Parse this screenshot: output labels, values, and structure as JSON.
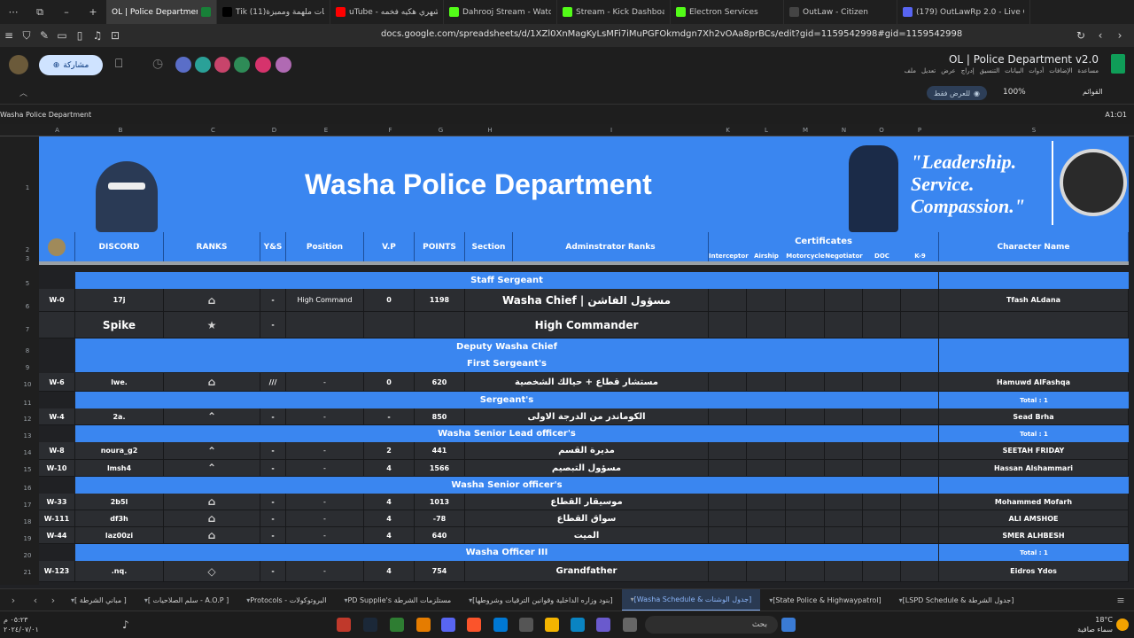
{
  "browser_tabs": [
    {
      "label": "OL | Police Department v2",
      "active": true,
      "color": "#188038"
    },
    {
      "label": "Tik (11)اقتباسات ملهمة ومميزة",
      "active": false,
      "color": "#000000"
    },
    {
      "label": "uTube - لعب شهري هكيه فخمه",
      "active": false,
      "color": "#ff0000"
    },
    {
      "label": "Dahrooj Stream - Watch Live o",
      "active": false,
      "color": "#53fc18"
    },
    {
      "label": "Stream - Kick Dashboard",
      "active": false,
      "color": "#53fc18"
    },
    {
      "label": "Electron Services",
      "active": false,
      "color": "#53fc18"
    },
    {
      "label": "OutLaw - Citizen",
      "active": false,
      "color": "#444444"
    },
    {
      "label": "(179) OutLawRp 2.0 - Live Conv",
      "active": false,
      "color": "#5865f2"
    }
  ],
  "url": "docs.google.com/spreadsheets/d/1XZl0XnMagKyLsMFi7iMuPGFOkmdgn7Xh2vOAa8prBCs/edit?gid=1159542998#gid=1159542998",
  "doc": {
    "title": "OL | Police Department v2.0",
    "menus": [
      "ملف",
      "تعديل",
      "عرض",
      "إدراج",
      "التنسيق",
      "البيانات",
      "أدوات",
      "الإضافات",
      "مساعدة"
    ],
    "share_label": "مشاركة",
    "view_only": "للعرض فقط",
    "zoom": "100%",
    "filter_label": "القوائم",
    "cell_ref": "A1:O1",
    "formula_text": "Washa Police Department"
  },
  "columns": [
    "A",
    "B",
    "C",
    "D",
    "E",
    "F",
    "G",
    "H",
    "I",
    "K",
    "L",
    "M",
    "N",
    "O",
    "P",
    "S"
  ],
  "rows": [
    "1",
    "2",
    "3",
    "5",
    "6",
    "7",
    "8",
    "9",
    "10",
    "11",
    "12",
    "13",
    "14",
    "15",
    "16",
    "17",
    "18",
    "19",
    "20",
    "21"
  ],
  "banner": {
    "title": "Washa Police Department",
    "quote": [
      "\"Leadership.",
      "Service.",
      "Compassion.\""
    ]
  },
  "headers": {
    "discord": "DISCORD",
    "ranks": "RANKS",
    "ys": "Y&S",
    "position": "Position",
    "vp": "V.P",
    "points": "POINTS",
    "section": "Section",
    "admin": "Adminstrator Ranks",
    "certs": "Certificates",
    "charname": "Character Name",
    "certs_sub": [
      "Interceptor",
      "Airship",
      "Motorcycle",
      "Negotiator",
      "DOC",
      "K-9"
    ]
  },
  "sections": {
    "staff": "Staff Sergeant",
    "deputy": "Deputy Washa Chief",
    "first": "First Sergeant's",
    "sergeant": "Sergeant's",
    "senior_lead": "Washa Senior Lead officer's",
    "senior": "Washa Senior officer's",
    "officer3": "Washa Officer III",
    "total": "Total : 1"
  },
  "members": [
    {
      "id": "W-0",
      "discord": "17j",
      "rank": "⌂",
      "ys": "-",
      "position": "High Command",
      "vp": "0",
      "points": "1198",
      "admin": "Washa Chief  | مسؤول الفاشن",
      "name": "Tfash ALdana"
    },
    {
      "id": "",
      "discord": "Spike",
      "rank": "★",
      "ys": "-",
      "position": "",
      "vp": "",
      "points": "",
      "admin": "High Commander",
      "name": ""
    },
    {
      "id": "W-6",
      "discord": "lwe.",
      "rank": "⌂",
      "ys": "///",
      "position": "-",
      "vp": "0",
      "points": "620",
      "admin": "مستشار قطاع + حيالك الشخصية",
      "name": "Hamuwd  AlFashqa"
    },
    {
      "id": "W-4",
      "discord": "2a.",
      "rank": "⌃",
      "ys": "-",
      "position": "-",
      "vp": "-",
      "points": "850",
      "admin": "الكوماندر من الدرجة الاولى",
      "name": "Sead Brha"
    },
    {
      "id": "W-8",
      "discord": "noura_g2",
      "rank": "⌃",
      "ys": "-",
      "position": "-",
      "vp": "2",
      "points": "441",
      "admin": "مديرة القسم",
      "name": "SEETAH FRIDAY"
    },
    {
      "id": "W-10",
      "discord": "lmsh4",
      "rank": "⌃",
      "ys": "-",
      "position": "-",
      "vp": "4",
      "points": "1566",
      "admin": "مسؤول التبصيم",
      "name": "Hassan Alshammari"
    },
    {
      "id": "W-33",
      "discord": "2b5l",
      "rank": "⌂",
      "ys": "-",
      "position": "-",
      "vp": "4",
      "points": "1013",
      "admin": "موسيقار القطاع",
      "name": "Mohammed Mofarh"
    },
    {
      "id": "W-111",
      "discord": "df3h",
      "rank": "⌂",
      "ys": "-",
      "position": "-",
      "vp": "4",
      "points": "-78",
      "admin": "سواق القطاع",
      "name": "ALI AMSHOE"
    },
    {
      "id": "W-44",
      "discord": "laz00zi",
      "rank": "⌂",
      "ys": "-",
      "position": "-",
      "vp": "4",
      "points": "640",
      "admin": "الميت",
      "name": "SMER ALHBESH"
    },
    {
      "id": "W-123",
      "discord": ".nq.",
      "rank": "◇",
      "ys": "-",
      "position": "-",
      "vp": "4",
      "points": "754",
      "admin": "Grandfather",
      "name": "Eidros Ydos"
    }
  ],
  "sheet_tabs": [
    "[ مباني الشرطة ]",
    "[ سلم الصلاحيات - A.O.P ]",
    "Protocols - البروتوكولات",
    "PD Supplie's مستلزمات الشرطة",
    "[بنود وزاره الداخلية وقوانين الترقيات وشروطها]",
    "[Washa Schedule & جدول الوشنات]",
    "[State Police & Highwaypatrol]",
    "[LSPD Schedule & جدول الشرطة]"
  ],
  "active_sheet": "[Washa Schedule & جدول الوشنات]",
  "taskbar": {
    "search": "بحث",
    "temp": "18°C",
    "weather": "سماء صافية",
    "time": "٠٥:٢٣ م",
    "date": "٢٠٢٤/٠٧/٠١"
  }
}
